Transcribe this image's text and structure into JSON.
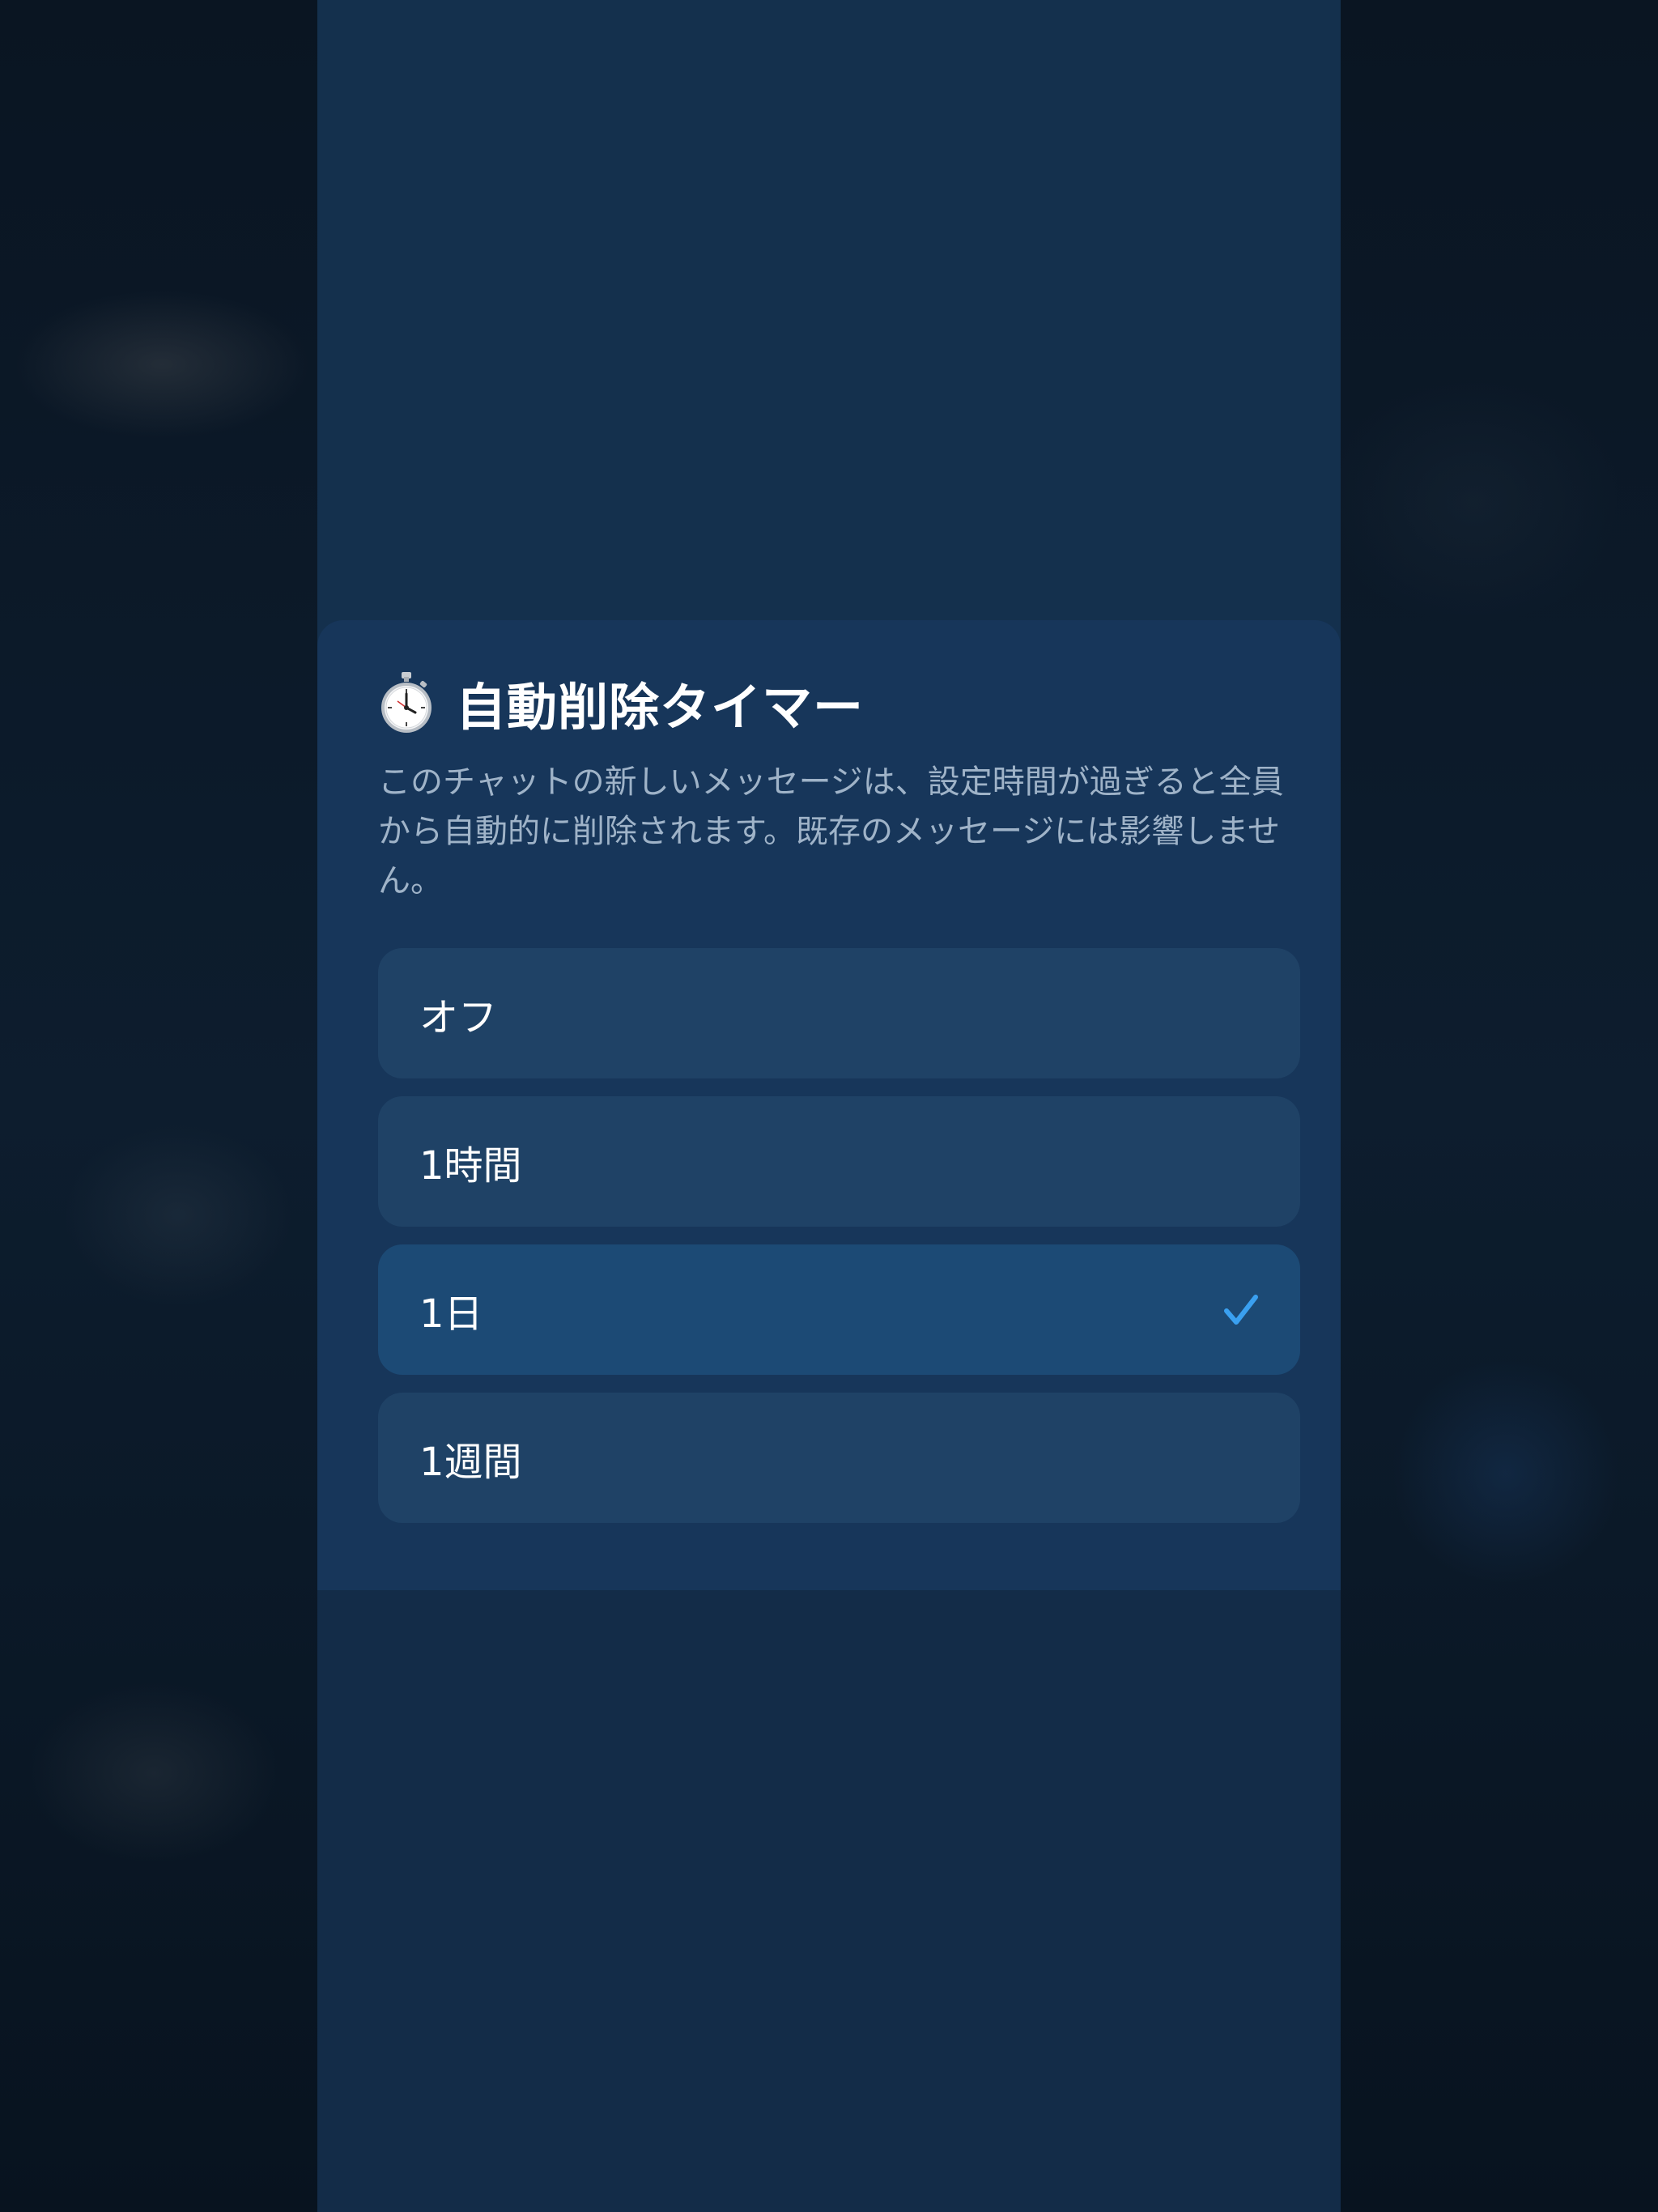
{
  "sheet": {
    "title": "自動削除タイマー",
    "icon": "stopwatch-icon",
    "description": "このチャットの新しいメッセージは、設定時間が過ぎると全員から自動的に削除されます。既存のメッセージには影響しません。"
  },
  "options": [
    {
      "label": "オフ",
      "selected": false
    },
    {
      "label": "1時間",
      "selected": false
    },
    {
      "label": "1日",
      "selected": true
    },
    {
      "label": "1週間",
      "selected": false
    }
  ],
  "colors": {
    "sheet_background": "#17365a",
    "option_background": "#1f4266",
    "option_selected_background": "#1c4a75",
    "check_accent": "#3aa0f0",
    "description_text": "#9fb3c8"
  }
}
